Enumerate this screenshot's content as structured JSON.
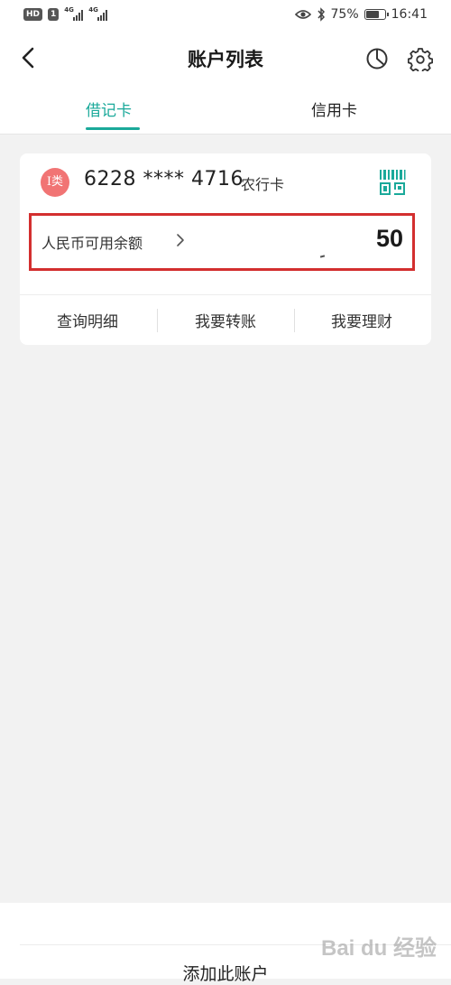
{
  "status_bar": {
    "hd_badge": "HD",
    "sim_slot": "1",
    "network_1": "4G",
    "network_2": "4G",
    "battery_percent_label": "75%",
    "battery_level": 0.75,
    "time": "16:41"
  },
  "nav": {
    "title": "账户列表"
  },
  "tabs": [
    {
      "label": "借记卡",
      "active": true
    },
    {
      "label": "信用卡",
      "active": false
    }
  ],
  "card": {
    "type_badge": "I类",
    "number": "6228 **** 4716",
    "bank": "农行卡",
    "balance_label": "人民币可用余额",
    "balance_value": "50",
    "actions": [
      "查询明细",
      "我要转账",
      "我要理财"
    ]
  },
  "bottom": {
    "add_account_label": "添加此账户"
  },
  "watermark": "Bai du 经验",
  "colors": {
    "accent": "#1aa99a",
    "badge": "#f17474",
    "highlight_border": "#d32f2f",
    "background": "#f2f2f2"
  }
}
